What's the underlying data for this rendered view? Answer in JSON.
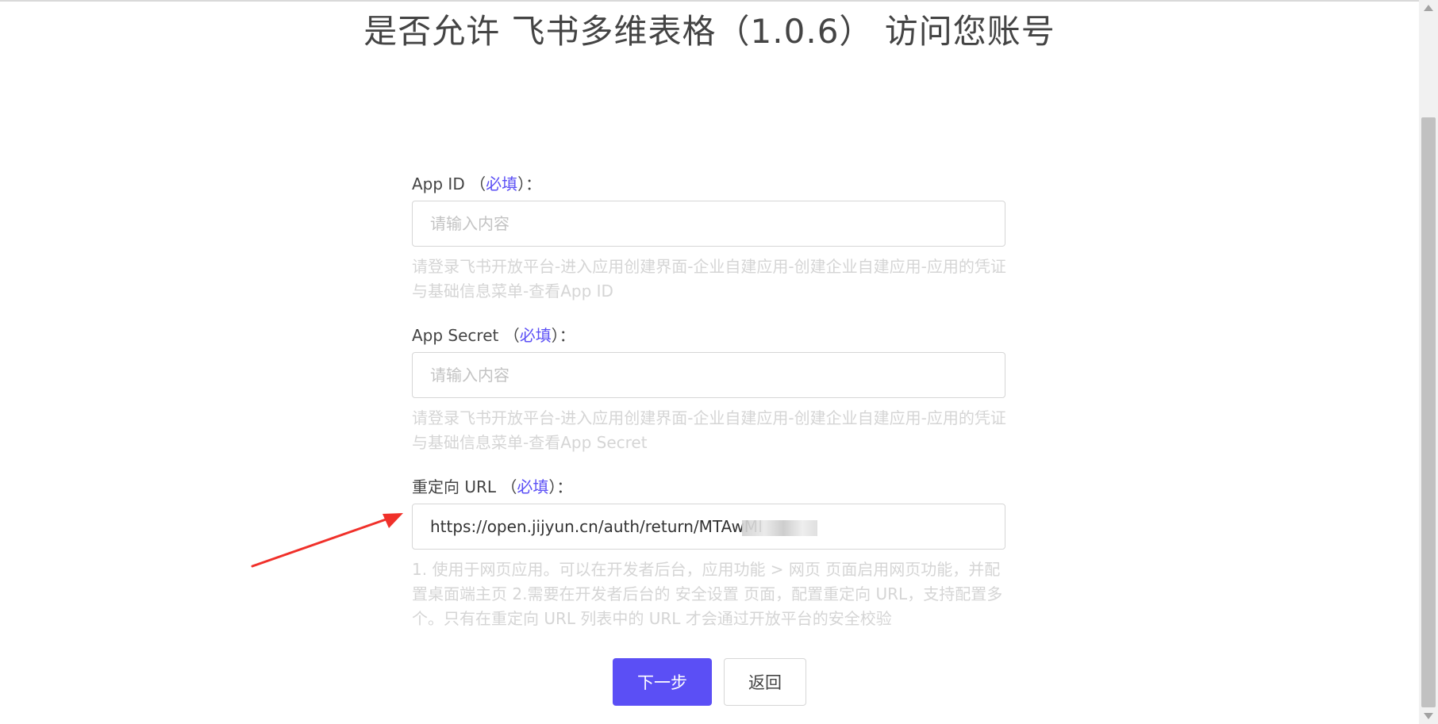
{
  "page": {
    "title": "是否允许 飞书多维表格（1.0.6） 访问您账号"
  },
  "form": {
    "required_mark": "必填",
    "app_id": {
      "label": "App ID",
      "placeholder": "请输入内容",
      "help": "请登录飞书开放平台-进入应用创建界面-企业自建应用-创建企业自建应用-应用的凭证与基础信息菜单-查看App ID"
    },
    "app_secret": {
      "label": "App Secret",
      "placeholder": "请输入内容",
      "help": "请登录飞书开放平台-进入应用创建界面-企业自建应用-创建企业自建应用-应用的凭证与基础信息菜单-查看App Secret"
    },
    "redirect_url": {
      "label": "重定向 URL",
      "value": "https://open.jijyun.cn/auth/return/MTAwMI",
      "help": "1. 使用于网页应用。可以在开发者后台，应用功能 > 网页 页面启用网页功能，并配置桌面端主页 2.需要在开发者后台的 安全设置 页面，配置重定向 URL，支持配置多个。只有在重定向 URL 列表中的 URL 才会通过开放平台的安全校验"
    }
  },
  "buttons": {
    "next": "下一步",
    "back": "返回"
  },
  "colors": {
    "accent": "#5b4ff5",
    "arrow": "#f0302a",
    "help_text": "#d5d5d5"
  }
}
